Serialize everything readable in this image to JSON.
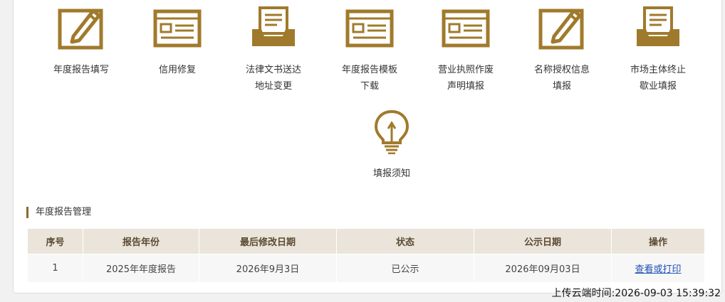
{
  "tiles": [
    {
      "label_lines": [
        "年度报告填写"
      ],
      "icon": "edit-document-icon"
    },
    {
      "label_lines": [
        "信用修复"
      ],
      "icon": "form-window-icon"
    },
    {
      "label_lines": [
        "法律文书送达",
        "地址变更"
      ],
      "icon": "document-tray-icon"
    },
    {
      "label_lines": [
        "年度报告模板",
        "下载"
      ],
      "icon": "form-window-icon"
    },
    {
      "label_lines": [
        "营业执照作废",
        "声明填报"
      ],
      "icon": "form-window-icon"
    },
    {
      "label_lines": [
        "名称授权信息",
        "填报"
      ],
      "icon": "edit-document-icon"
    },
    {
      "label_lines": [
        "市场主体终止",
        "歇业填报"
      ],
      "icon": "document-tray-icon"
    },
    {
      "label_lines": [
        "填报须知"
      ],
      "icon": "lightbulb-icon"
    }
  ],
  "section_title": "年度报告管理",
  "table": {
    "headers": [
      "序号",
      "报告年份",
      "最后修改日期",
      "状态",
      "公示日期",
      "操作"
    ],
    "rows": [
      [
        "1",
        "2025年年度报告",
        "2026年9月3日",
        "已公示",
        "2026年09月03日",
        "查看或打印"
      ]
    ]
  },
  "upload_time": "上传云端时间:2026-09-03 15:39:32",
  "colors": {
    "accent": "#a07a2c",
    "header_bg": "#ebe4da"
  }
}
